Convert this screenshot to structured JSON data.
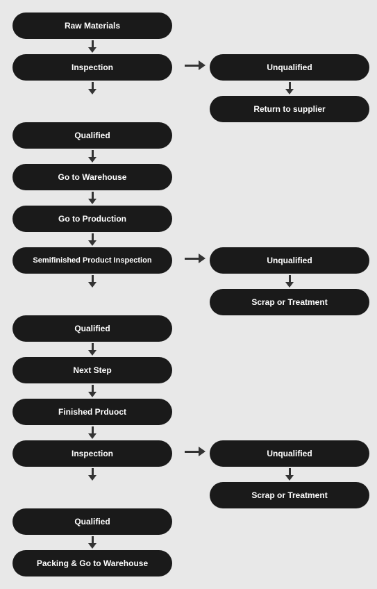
{
  "nodes": {
    "raw_materials": "Raw Materials",
    "inspection1": "Inspection",
    "qualified1": "Qualified",
    "go_to_warehouse": "Go to Warehouse",
    "go_to_production": "Go to Production",
    "semifinished_inspection": "Semifinished Product Inspection",
    "qualified2": "Qualified",
    "next_step": "Next Step",
    "finished_product": "Finished Prduoct",
    "inspection2": "Inspection",
    "qualified3": "Qualified",
    "packing": "Packing & Go to Warehouse",
    "unqualified1": "Unqualified",
    "return_supplier": "Return to supplier",
    "unqualified2": "Unqualified",
    "scrap_treatment1": "Scrap or Treatment",
    "unqualified3": "Unqualified",
    "scrap_treatment2": "Scrap or Treatment"
  }
}
